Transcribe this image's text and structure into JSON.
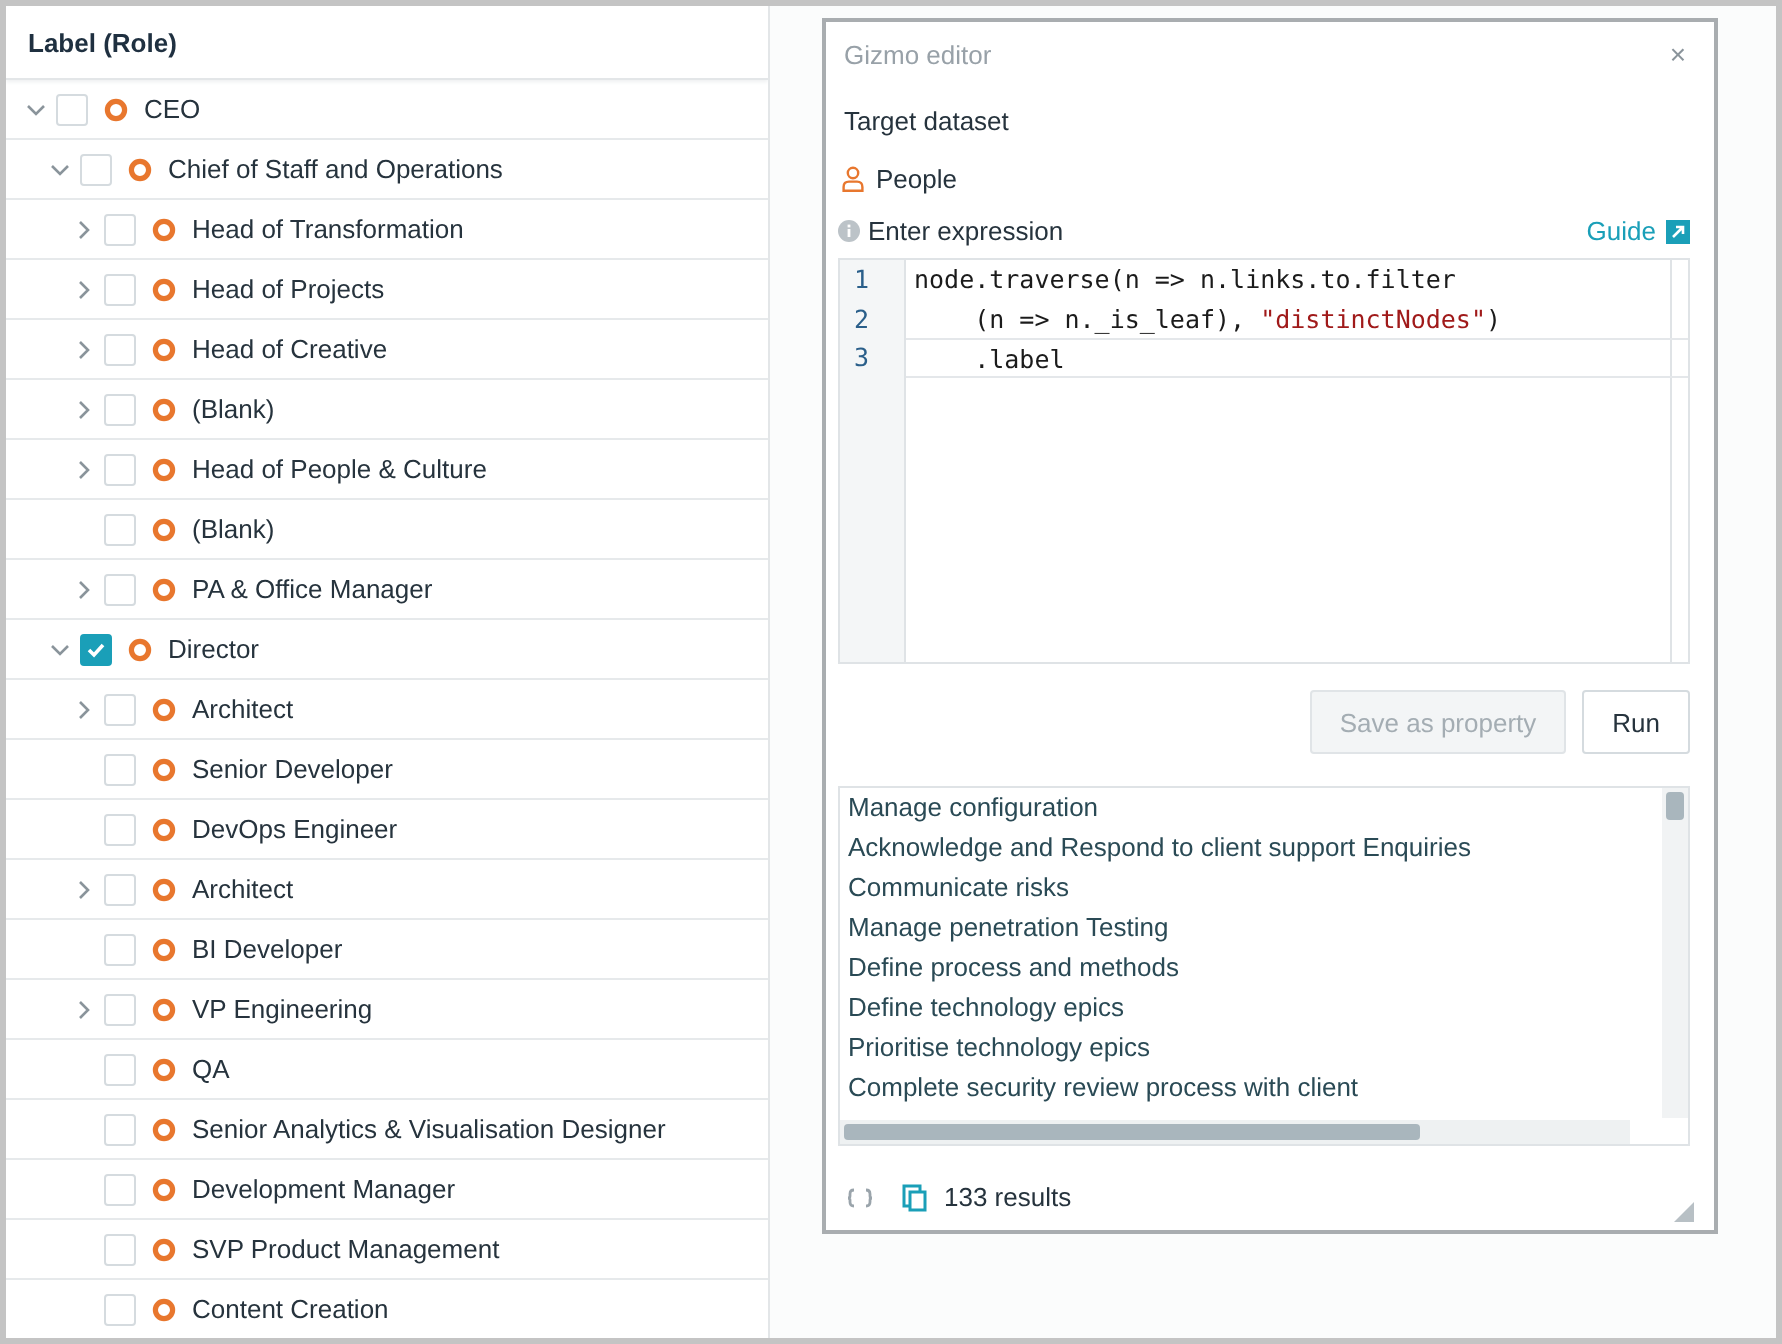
{
  "tree": {
    "header": "Label (Role)",
    "nodes": [
      {
        "label": "CEO",
        "expanded": true,
        "checked": false,
        "children": [
          {
            "label": "Chief of Staff and Operations",
            "expanded": true,
            "checked": false,
            "children": [
              {
                "label": "Head of Transformation",
                "expanded": false,
                "checked": false
              },
              {
                "label": "Head of Projects",
                "expanded": false,
                "checked": false
              },
              {
                "label": "Head of Creative",
                "expanded": false,
                "checked": false
              },
              {
                "label": "(Blank)",
                "expanded": false,
                "checked": false
              },
              {
                "label": "Head of People & Culture",
                "expanded": false,
                "checked": false
              },
              {
                "label": "(Blank)",
                "checked": false
              },
              {
                "label": "PA & Office Manager",
                "expanded": false,
                "checked": false
              }
            ]
          },
          {
            "label": "Director",
            "expanded": true,
            "checked": true,
            "children": [
              {
                "label": "Architect",
                "expanded": false,
                "checked": false
              },
              {
                "label": "Senior Developer",
                "checked": false
              },
              {
                "label": "DevOps Engineer",
                "checked": false
              },
              {
                "label": "Architect",
                "expanded": false,
                "checked": false
              },
              {
                "label": "BI Developer",
                "checked": false
              },
              {
                "label": "VP Engineering",
                "expanded": false,
                "checked": false
              },
              {
                "label": "QA",
                "checked": false
              },
              {
                "label": "Senior Analytics & Visualisation Designer",
                "checked": false
              },
              {
                "label": "Development Manager",
                "checked": false
              },
              {
                "label": "SVP Product Management",
                "checked": false
              },
              {
                "label": "Content Creation",
                "checked": false
              }
            ]
          }
        ]
      }
    ]
  },
  "editor": {
    "title": "Gizmo editor",
    "close": "×",
    "target_label": "Target dataset",
    "dataset": "People",
    "expression_label": "Enter expression",
    "guide_link": "Guide",
    "code_lines": [
      {
        "number": "1",
        "current": false,
        "tokens": [
          {
            "kind": "plain",
            "text": "node.traverse(n => n.links.to.filter"
          }
        ]
      },
      {
        "number": "2",
        "current": false,
        "tokens": [
          {
            "kind": "plain",
            "text": "    (n => n._is_leaf), "
          },
          {
            "kind": "string",
            "text": "\"distinctNodes\""
          },
          {
            "kind": "plain",
            "text": ")"
          }
        ]
      },
      {
        "number": "3",
        "current": true,
        "tokens": [
          {
            "kind": "plain",
            "text": "    .label"
          }
        ]
      }
    ],
    "buttons": [
      {
        "label": "Save as property",
        "disabled": true
      },
      {
        "label": "Run",
        "disabled": false
      }
    ],
    "results": [
      "Manage configuration",
      "Acknowledge and Respond to client support Enquiries",
      "Communicate risks",
      "Manage penetration Testing",
      "Define process and methods",
      "Define technology epics",
      "Prioritise technology epics",
      "Complete security review process with client"
    ],
    "result_count": "133 results"
  }
}
